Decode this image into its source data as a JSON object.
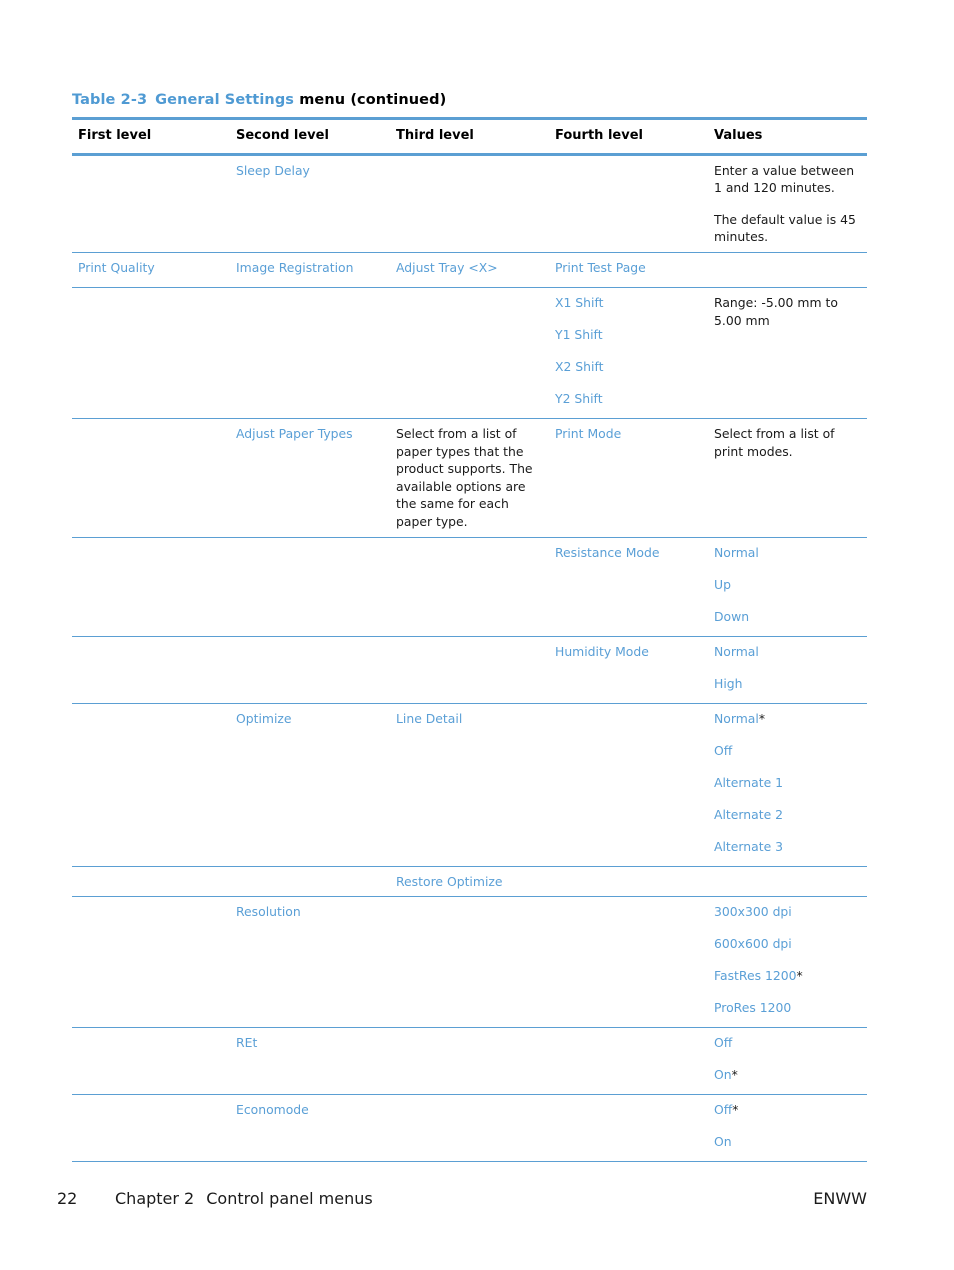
{
  "caption": {
    "table_number": "Table 2-3",
    "menu_name": "General Settings",
    "suffix": "menu (continued)"
  },
  "table": {
    "headers": [
      "First level",
      "Second level",
      "Third level",
      "Fourth level",
      "Values"
    ],
    "rows": [
      {
        "first": "",
        "second": "Sleep Delay",
        "third": "",
        "fourth": [],
        "values_text": [
          "Enter a value between 1 and 120 minutes.",
          "The default value is 45 minutes."
        ],
        "values": []
      },
      {
        "first": "Print Quality",
        "second": "Image Registration",
        "third": "Adjust Tray <X>",
        "fourth": [
          "Print Test Page"
        ],
        "values_text": [],
        "values": []
      },
      {
        "first": "",
        "second": "",
        "third": "",
        "fourth": [
          "X1 Shift",
          "Y1 Shift",
          "X2 Shift",
          "Y2 Shift"
        ],
        "values_text": [
          "Range: -5.00 mm to 5.00 mm"
        ],
        "values": []
      },
      {
        "first": "",
        "second": "Adjust Paper Types",
        "third_text": "Select from a list of paper types that the product supports. The available options are the same for each paper type.",
        "fourth": [
          "Print Mode"
        ],
        "values_text": [
          "Select from a list of print modes."
        ],
        "values": []
      },
      {
        "first": "",
        "second": "",
        "third": "",
        "fourth": [
          "Resistance Mode"
        ],
        "values_text": [],
        "values": [
          {
            "label": "Normal",
            "default": false
          },
          {
            "label": "Up",
            "default": false
          },
          {
            "label": "Down",
            "default": false
          }
        ]
      },
      {
        "first": "",
        "second": "",
        "third": "",
        "fourth": [
          "Humidity Mode"
        ],
        "values_text": [],
        "values": [
          {
            "label": "Normal",
            "default": false
          },
          {
            "label": "High",
            "default": false
          }
        ]
      },
      {
        "first": "",
        "second": "Optimize",
        "third": "Line Detail",
        "fourth": [],
        "values_text": [],
        "values": [
          {
            "label": "Normal",
            "default": true
          },
          {
            "label": "Off",
            "default": false
          },
          {
            "label": "Alternate 1",
            "default": false
          },
          {
            "label": "Alternate 2",
            "default": false
          },
          {
            "label": "Alternate 3",
            "default": false
          }
        ]
      },
      {
        "first": "",
        "second": "",
        "third": "Restore Optimize",
        "fourth": [],
        "values_text": [],
        "values": []
      },
      {
        "first": "",
        "second": "Resolution",
        "third": "",
        "fourth": [],
        "values_text": [],
        "values": [
          {
            "label": "300x300 dpi",
            "default": false
          },
          {
            "label": "600x600 dpi",
            "default": false
          },
          {
            "label": "FastRes 1200",
            "default": true
          },
          {
            "label": "ProRes 1200",
            "default": false
          }
        ]
      },
      {
        "first": "",
        "second": "REt",
        "third": "",
        "fourth": [],
        "values_text": [],
        "values": [
          {
            "label": "Off",
            "default": false
          },
          {
            "label": "On",
            "default": true
          }
        ]
      },
      {
        "first": "",
        "second": "Economode",
        "third": "",
        "fourth": [],
        "values_text": [],
        "values": [
          {
            "label": "Off",
            "default": true
          },
          {
            "label": "On",
            "default": false
          }
        ]
      }
    ],
    "default_marker": "*"
  },
  "footer": {
    "page_number": "22",
    "chapter": "Chapter 2",
    "chapter_title": "Control panel menus",
    "doc_code": "ENWW"
  },
  "colors": {
    "accent": "#4f9ad3",
    "link": "#5a9fd6",
    "rule": "#5b9fd3",
    "text": "#1a1a1a"
  }
}
